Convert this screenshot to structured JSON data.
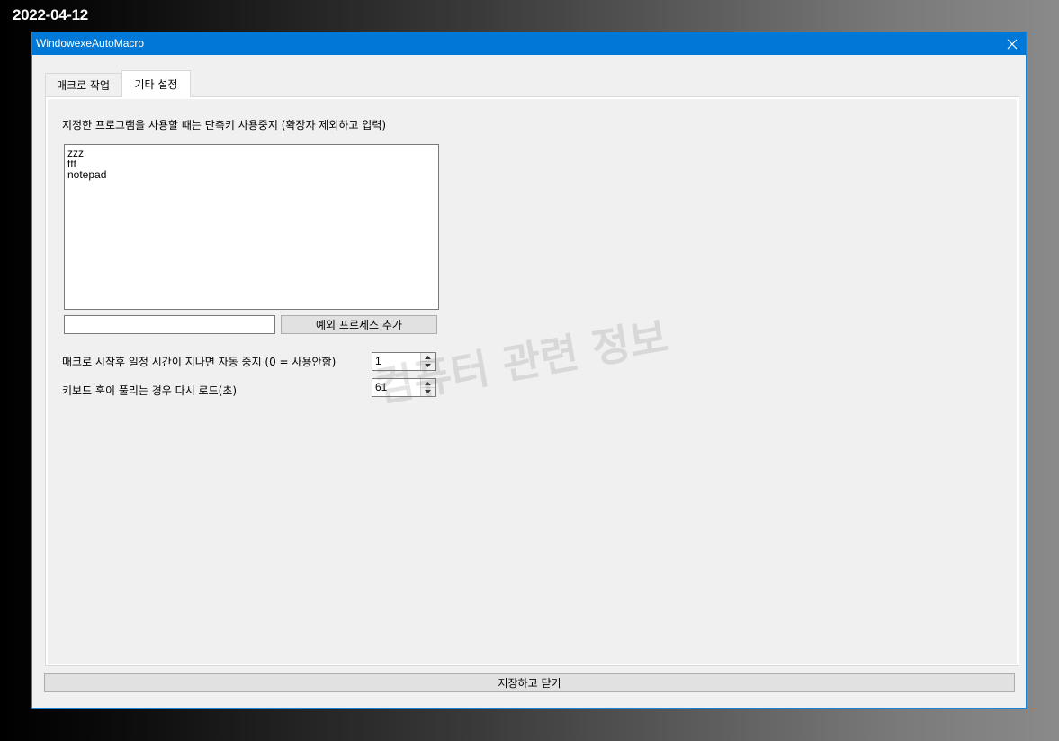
{
  "date_label": "2022-04-12",
  "window": {
    "title": "WindowexeAutoMacro"
  },
  "tabs": [
    {
      "label": "매크로 작업",
      "selected": false
    },
    {
      "label": "기타 설정",
      "selected": true
    }
  ],
  "settings": {
    "exclusion_label": "지정한 프로그램을 사용할 때는 단축키 사용중지 (확장자 제외하고 입력)",
    "exclusion_list": [
      "zzz",
      "ttt",
      "notepad"
    ],
    "process_input_value": "",
    "add_process_button": "예외 프로세스 추가",
    "auto_stop_label": "매크로 시작후 일정 시간이 지나면 자동 중지 (0 = 사용안함)",
    "auto_stop_value": "1",
    "reload_label": "키보드 훅이 풀리는 경우 다시 로드(초)",
    "reload_value": "61"
  },
  "save_close_button": "저장하고 닫기",
  "watermark": "컴퓨터 관련 정보",
  "colors": {
    "titlebar": "#0078d7",
    "window_bg": "#f0f0f0",
    "button_bg": "#e1e1e1"
  },
  "icons": {
    "close": "close-icon",
    "spin_up": "chevron-up-icon",
    "spin_down": "chevron-down-icon"
  }
}
